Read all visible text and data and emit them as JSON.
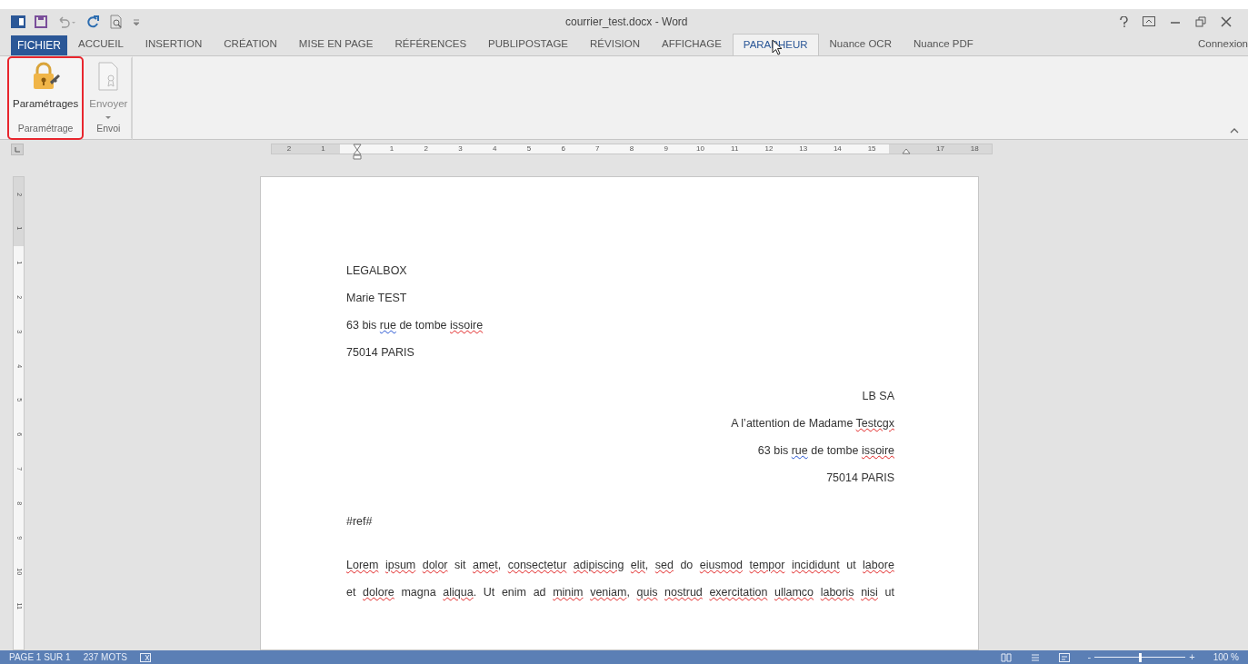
{
  "window": {
    "title": "courrier_test.docx - Word",
    "account": "Connexion"
  },
  "tabs": [
    {
      "label": "FICHIER",
      "kind": "file",
      "selected": false
    },
    {
      "label": "ACCUEIL",
      "kind": "tab",
      "selected": false
    },
    {
      "label": "INSERTION",
      "kind": "tab",
      "selected": false
    },
    {
      "label": "CRÉATION",
      "kind": "tab",
      "selected": false
    },
    {
      "label": "MISE EN PAGE",
      "kind": "tab",
      "selected": false
    },
    {
      "label": "RÉFÉRENCES",
      "kind": "tab",
      "selected": false
    },
    {
      "label": "PUBLIPOSTAGE",
      "kind": "tab",
      "selected": false
    },
    {
      "label": "RÉVISION",
      "kind": "tab",
      "selected": false
    },
    {
      "label": "AFFICHAGE",
      "kind": "tab",
      "selected": false
    },
    {
      "label": "PARAPHEUR",
      "kind": "tab",
      "selected": true
    },
    {
      "label": "Nuance OCR",
      "kind": "tab",
      "selected": false
    },
    {
      "label": "Nuance PDF",
      "kind": "tab",
      "selected": false
    }
  ],
  "ribbon": {
    "groups": [
      {
        "label": "Paramétrage",
        "highlighted": true,
        "button": {
          "label": "Paramétrages",
          "kind": "lock",
          "disabled": false,
          "dropdown": false
        }
      },
      {
        "label": "Envoi",
        "highlighted": false,
        "button": {
          "label": "Envoyer",
          "kind": "document",
          "disabled": true,
          "dropdown": true
        }
      }
    ]
  },
  "ruler": {
    "marks": [
      {
        "kind": "number",
        "text": "2"
      },
      {
        "kind": "number",
        "text": "1"
      },
      {
        "kind": "indent"
      },
      {
        "kind": "number",
        "text": "1"
      },
      {
        "kind": "number",
        "text": "2"
      },
      {
        "kind": "number",
        "text": "3"
      },
      {
        "kind": "number",
        "text": "4"
      },
      {
        "kind": "number",
        "text": "5"
      },
      {
        "kind": "number",
        "text": "6"
      },
      {
        "kind": "number",
        "text": "7"
      },
      {
        "kind": "number",
        "text": "8"
      },
      {
        "kind": "number",
        "text": "9"
      },
      {
        "kind": "number",
        "text": "10"
      },
      {
        "kind": "number",
        "text": "11"
      },
      {
        "kind": "number",
        "text": "12"
      },
      {
        "kind": "number",
        "text": "13"
      },
      {
        "kind": "number",
        "text": "14"
      },
      {
        "kind": "number",
        "text": "15"
      },
      {
        "kind": "right-indent"
      },
      {
        "kind": "number",
        "text": "17"
      },
      {
        "kind": "number",
        "text": "18"
      }
    ],
    "vertical": [
      "2",
      "1",
      "1",
      "2",
      "3",
      "4",
      "5",
      "6",
      "7",
      "8",
      "9",
      "10",
      "11"
    ]
  },
  "document": {
    "blocks": [
      {
        "kind": "left",
        "lines": [
          {
            "words": [
              {
                "text": "LEGALBOX"
              }
            ]
          },
          {
            "words": [
              {
                "text": "Marie"
              },
              {
                "text": "TEST"
              }
            ]
          },
          {
            "words": [
              {
                "text": "63"
              },
              {
                "text": "bis"
              },
              {
                "text": "rue",
                "grammar": true
              },
              {
                "text": "de"
              },
              {
                "text": "tombe"
              },
              {
                "text": "issoire",
                "spelling": true
              }
            ]
          },
          {
            "words": [
              {
                "text": "75014"
              },
              {
                "text": "PARIS"
              }
            ]
          }
        ]
      },
      {
        "kind": "right",
        "lines": [
          {
            "words": [
              {
                "text": "LB"
              },
              {
                "text": "SA"
              }
            ]
          },
          {
            "words": [
              {
                "text": "A"
              },
              {
                "text": "l’attention"
              },
              {
                "text": "de"
              },
              {
                "text": "Madame"
              },
              {
                "text": "Testcgx",
                "spelling": true
              }
            ]
          },
          {
            "words": [
              {
                "text": "63"
              },
              {
                "text": "bis"
              },
              {
                "text": "rue",
                "grammar": true
              },
              {
                "text": "de"
              },
              {
                "text": "tombe"
              },
              {
                "text": "issoire",
                "spelling": true
              }
            ]
          },
          {
            "words": [
              {
                "text": "75014"
              },
              {
                "text": "PARIS"
              }
            ]
          }
        ]
      },
      {
        "kind": "left",
        "lines": [
          {
            "words": [
              {
                "text": "#ref#"
              }
            ]
          }
        ]
      },
      {
        "kind": "justified",
        "lines": [
          {
            "words": [
              {
                "text": "Lorem",
                "spelling": true
              },
              {
                "text": "ipsum",
                "spelling": true
              },
              {
                "text": "dolor",
                "spelling": true
              },
              {
                "text": "sit"
              },
              {
                "text": "amet",
                "spelling": true,
                "after": ","
              },
              {
                "text": "consectetur",
                "spelling": true
              },
              {
                "text": "adipiscing",
                "spelling": true
              },
              {
                "text": "elit",
                "spelling": true,
                "after": ","
              },
              {
                "text": "sed",
                "spelling": true
              },
              {
                "text": "do"
              },
              {
                "text": "eiusmod",
                "spelling": true
              },
              {
                "text": "tempor",
                "spelling": true
              },
              {
                "text": "incididunt",
                "spelling": true
              },
              {
                "text": "ut"
              },
              {
                "text": "labore",
                "spelling": true
              }
            ]
          },
          {
            "words": [
              {
                "text": "et"
              },
              {
                "text": "dolore",
                "spelling": true
              },
              {
                "text": "magna"
              },
              {
                "text": "aliqua",
                "spelling": true,
                "after": "."
              },
              {
                "text": "Ut"
              },
              {
                "text": "enim"
              },
              {
                "text": "ad"
              },
              {
                "text": "minim",
                "spelling": true
              },
              {
                "text": "veniam",
                "spelling": true,
                "after": ","
              },
              {
                "text": "quis",
                "spelling": true
              },
              {
                "text": "nostrud",
                "spelling": true
              },
              {
                "text": "exercitation",
                "spelling": true
              },
              {
                "text": "ullamco",
                "spelling": true
              },
              {
                "text": "laboris",
                "spelling": true
              },
              {
                "text": "nisi",
                "spelling": true
              },
              {
                "text": "ut"
              }
            ]
          }
        ]
      }
    ]
  },
  "status_bar": {
    "page": "PAGE 1 SUR 1",
    "words": "237 MOTS",
    "zoom": {
      "minus": "-",
      "plus": "+",
      "level": 0.5,
      "reading": "100 %"
    }
  }
}
